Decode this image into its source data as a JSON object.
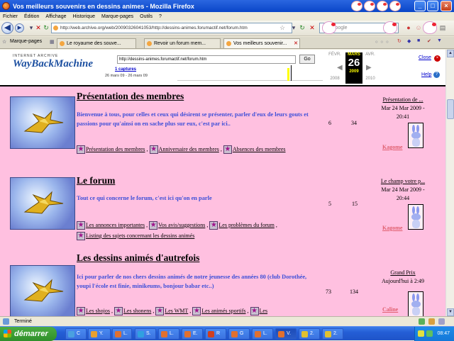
{
  "window": {
    "title": "Vos meilleurs souvenirs en dessins animes - Mozilla Firefox"
  },
  "menu": [
    "Fichier",
    "Édition",
    "Affichage",
    "Historique",
    "Marque-pages",
    "Outils",
    "?"
  ],
  "nav": {
    "url": "http://web.archive.org/web/20090326041053/http://dessins-animes.forumactif.net/forum.htm",
    "search_placeholder": "Google"
  },
  "tabs": {
    "bookmarks_label": "Marque-pages",
    "items": [
      "Le royaume des souve...",
      "Revoir un forum mem...",
      "Vos meilleurs souvenir..."
    ]
  },
  "wayback": {
    "logo_top": "INTERNET ARCHIVE",
    "logo_name": "WayBackMachine",
    "url": "http://dessins-animes.forumactif.net/forum.htm",
    "go": "Go",
    "captures": "1 captures",
    "range": "26 mars 09 - 26 mars 09",
    "prev_month": "FÉVR.",
    "cur_month": "MARS",
    "cur_day": "26",
    "cur_year": "2009",
    "next_month": "AVR.",
    "prev_year": "2008",
    "next_year": "2010",
    "close": "Close",
    "help": "Help"
  },
  "forums": [
    {
      "title": "Présentation des membres",
      "desc": "Bienvenue à tous, pour celles et ceux qui désirent se présenter, parler d'eux de leurs gouts et passions pour qu'ainsi on en sache plus sur eux, c'est par ici..",
      "subforums": [
        "Présentation des membres",
        "Anniversaire des membres",
        "Absences des membres"
      ],
      "topics": "6",
      "posts": "34",
      "last_title": "Présentation de ...",
      "last_date": "Mar 24 Mar 2009 -",
      "last_time": "20:41",
      "last_user": "Kagome"
    },
    {
      "title": "Le forum",
      "desc": "Tout ce qui concerne le forum, c'est ici qu'on en parle",
      "subforums": [
        "Les annonces importantes",
        "Vos avis/suggestions",
        "Les problèmes du forum",
        "Listing des sujets concernant les dessins animés"
      ],
      "topics": "5",
      "posts": "15",
      "last_title": "Le champ votre p...",
      "last_date": "Mar 24 Mar 2009 -",
      "last_time": "20:44",
      "last_user": "Kagome"
    },
    {
      "title": "Les dessins animés d'autrefois",
      "desc": "Ici pour parler de nos chers dessins animés de notre jeunesse des années 80 (club Dorothée, youpi l'école est finie, minikeums, bonjour babar etc..)",
      "subforums": [
        "Les shojos",
        "Les shonens",
        "Les WMT",
        "Les animés sportifs",
        "Les"
      ],
      "topics": "73",
      "posts": "134",
      "last_title": "Grand Prix",
      "last_date": "Aujourd'hui à 2:49",
      "last_time": "",
      "last_user": "Caline"
    }
  ],
  "status": {
    "text": "Terminé"
  },
  "taskbar": {
    "start": "démarrer",
    "tasks": [
      "C",
      "Y.",
      "L.",
      "S.",
      "L.",
      "E.",
      "R",
      "G",
      "L.",
      "V.",
      "2.",
      "2."
    ],
    "clock": "08:47"
  }
}
